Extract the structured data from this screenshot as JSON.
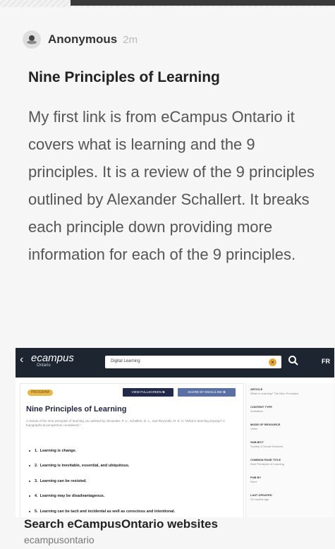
{
  "post": {
    "author": "Anonymous",
    "time": "2m",
    "title": "Nine Principles of Learning",
    "body": "My first link is from eCampus Ontario it covers what is learning and the 9 principles.  It is a review of the 9 principles outlined by Alexander Schallert. It breaks each principle down providing more information for each of the 9 principles."
  },
  "preview": {
    "logo": "ecampus",
    "logo_sub": "Ontario",
    "search_value": "Digital Learning",
    "clear_symbol": "×",
    "lang": "FR",
    "badge": "PROGRAM",
    "view_button": "VIEW FULLSCREEN ⧉",
    "share_button": "SHARE BY EMAIL/LINK ⧉",
    "heading": "Nine Principles of Learning",
    "note": "A review of the nine principles of learning, as outlined by Alexander, P. A., Schallert, D. L., and Reynolds, R. E. in “What is learning anyway? A topographical perspective considered.”",
    "principles": [
      {
        "num": "1.",
        "text": "Learning is change."
      },
      {
        "num": "2.",
        "text": "Learning is inevitable, essential, and ubiquitous."
      },
      {
        "num": "3.",
        "text": "Learning can be resisted."
      },
      {
        "num": "4.",
        "text": "Learning may be disadvantageous."
      },
      {
        "num": "5.",
        "text": "Learning can be tacit and incidental as well as conscious and intentional."
      }
    ],
    "meta": [
      {
        "label": "ARTICLE",
        "value": "What is Learning? The Nine Principles"
      },
      {
        "label": "CONTENT TYPE",
        "value": "Animation"
      },
      {
        "label": "MODE OF RESOURCE",
        "value": "Video"
      },
      {
        "label": "SUBJECT",
        "value": "Society & Social Sciences"
      },
      {
        "label": "COMMON PAGE TITLE",
        "value": "Nine Principles of Learning"
      },
      {
        "label": "PUB BY",
        "value": "None"
      },
      {
        "label": "LAST UPDATED",
        "value": "10 months ago"
      }
    ]
  },
  "link": {
    "title": "Search eCampusOntario websites",
    "domain": "ecampusontario"
  },
  "colors": {
    "preview_bar": "#1d2531",
    "badge": "#e8b84a",
    "button_dark": "#222a49",
    "button_light": "#5a6fa4"
  }
}
